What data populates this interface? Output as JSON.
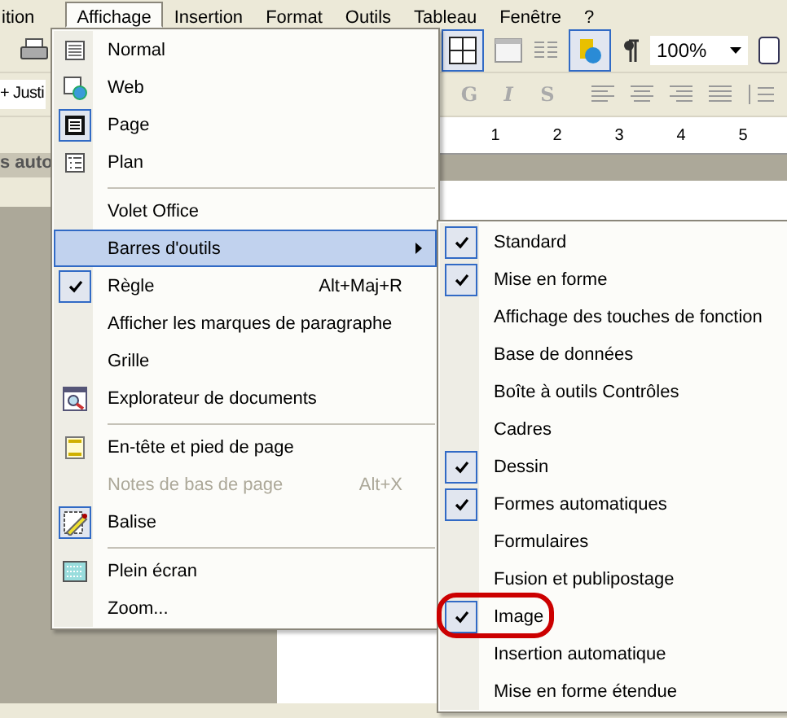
{
  "menu_bar": [
    {
      "label": "ition",
      "selected": false
    },
    {
      "label": "Affichage",
      "selected": true
    },
    {
      "label": "Insertion",
      "selected": false
    },
    {
      "label": "Format",
      "selected": false
    },
    {
      "label": "Outils",
      "selected": false
    },
    {
      "label": "Tableau",
      "selected": false
    },
    {
      "label": "Fenêtre",
      "selected": false
    },
    {
      "label": "?",
      "selected": false
    }
  ],
  "toolbar": {
    "style_box": "+ Justi",
    "format_buttons": [
      "G",
      "I",
      "S"
    ],
    "zoom_box": "100%"
  },
  "ruler": [
    "1",
    "2",
    "3",
    "4",
    "5"
  ],
  "task_pane": {
    "title": "s auto"
  },
  "view_menu": [
    {
      "label": "Normal",
      "checked": false,
      "selected": false,
      "disabled": false,
      "separator_before": false
    },
    {
      "label": "Web",
      "checked": false,
      "selected": false,
      "disabled": false,
      "separator_before": false
    },
    {
      "label": "Page",
      "checked": true,
      "selected": false,
      "disabled": false,
      "separator_before": false
    },
    {
      "label": "Plan",
      "checked": false,
      "selected": false,
      "disabled": false,
      "separator_before": false
    },
    {
      "label": "Volet Office",
      "checked": false,
      "selected": false,
      "disabled": false,
      "separator_before": true
    },
    {
      "label": "Barres d'outils",
      "checked": false,
      "selected": true,
      "disabled": false,
      "separator_before": false,
      "submenu": true
    },
    {
      "label": "Règle",
      "checked": true,
      "selected": false,
      "disabled": false,
      "separator_before": false,
      "shortcut": "Alt+Maj+R"
    },
    {
      "label": "Afficher les marques de paragraphe",
      "checked": false,
      "selected": false,
      "disabled": false,
      "separator_before": false
    },
    {
      "label": "Grille",
      "checked": false,
      "selected": false,
      "disabled": false,
      "separator_before": false
    },
    {
      "label": "Explorateur de documents",
      "checked": false,
      "selected": false,
      "disabled": false,
      "separator_before": false
    },
    {
      "label": "En-tête et pied de page",
      "checked": false,
      "selected": false,
      "disabled": false,
      "separator_before": true
    },
    {
      "label": "Notes de bas de page",
      "checked": false,
      "selected": false,
      "disabled": true,
      "separator_before": false,
      "shortcut": "Alt+X"
    },
    {
      "label": "Balise",
      "checked": true,
      "selected": false,
      "disabled": false,
      "separator_before": false
    },
    {
      "label": "Plein écran",
      "checked": false,
      "selected": false,
      "disabled": false,
      "separator_before": true
    },
    {
      "label": "Zoom...",
      "checked": false,
      "selected": false,
      "disabled": false,
      "separator_before": false
    }
  ],
  "toolbars_submenu": [
    {
      "label": "Standard",
      "checked": true,
      "circled": false
    },
    {
      "label": "Mise en forme",
      "checked": true,
      "circled": false
    },
    {
      "label": "Affichage des touches de fonction",
      "checked": false,
      "circled": false
    },
    {
      "label": "Base de données",
      "checked": false,
      "circled": false
    },
    {
      "label": "Boîte à outils Contrôles",
      "checked": false,
      "circled": false
    },
    {
      "label": "Cadres",
      "checked": false,
      "circled": false
    },
    {
      "label": "Dessin",
      "checked": true,
      "circled": false
    },
    {
      "label": "Formes automatiques",
      "checked": true,
      "circled": false
    },
    {
      "label": "Formulaires",
      "checked": false,
      "circled": false
    },
    {
      "label": "Fusion et publipostage",
      "checked": false,
      "circled": false
    },
    {
      "label": "Image",
      "checked": true,
      "circled": true
    },
    {
      "label": "Insertion automatique",
      "checked": false,
      "circled": false
    },
    {
      "label": "Mise en forme étendue",
      "checked": false,
      "circled": false
    }
  ]
}
